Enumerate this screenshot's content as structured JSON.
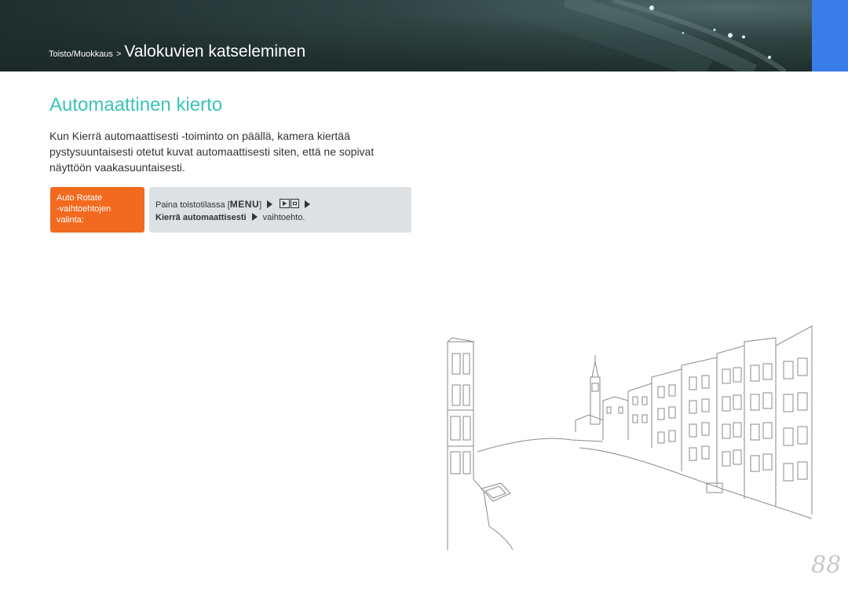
{
  "header": {
    "section_small": "Toisto/Muokkaus",
    "separator": ">",
    "section_title": "Valokuvien katseleminen"
  },
  "heading": "Automaattinen kierto",
  "intro": "Kun Kierrä automaattisesti -toiminto on päällä, kamera kiertää pystysuuntaisesti otetut kuvat automaattisesti siten, että ne sopivat näyttöön vaakasuuntaisesti.",
  "instruction": {
    "label_line1": "Auto Rotate",
    "label_line2": "-vaihtoehtojen",
    "label_line3": "valinta:",
    "step_prefix": "Paina toistotilassa [",
    "menu_key": "MENU",
    "step_bracket_close": "]",
    "option_name": "Kierrä automaattisesti",
    "option_suffix": "vaihtoehto.",
    "icons": [
      "play-menu-icon",
      "edit-icon",
      "arrow-right-icon"
    ]
  },
  "page_number": "88",
  "colors": {
    "accent_teal": "#3bc4b6",
    "label_orange": "#f26a1f",
    "box_gray": "#dde1e3",
    "header_dark": "#1f2f2e",
    "tab_blue": "#3a7de8"
  }
}
